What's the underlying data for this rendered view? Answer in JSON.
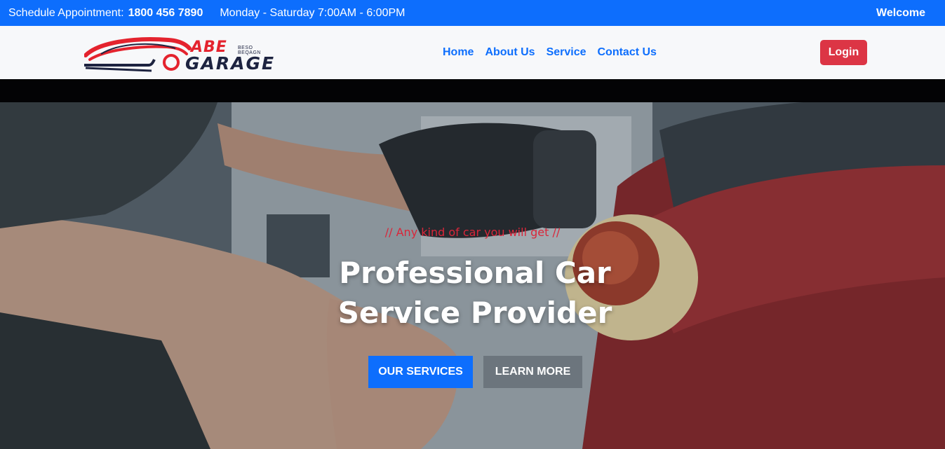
{
  "topbar": {
    "schedule_label": "Schedule Appointment:",
    "phone": "1800 456 7890",
    "hours": "Monday - Saturday 7:00AM - 6:00PM",
    "welcome": "Welcome"
  },
  "logo": {
    "line1": "ABE",
    "line2": "GARAGE",
    "tag": "BESO BEQAGN"
  },
  "nav": {
    "links": [
      "Home",
      "About Us",
      "Service",
      "Contact Us"
    ],
    "login_label": "Login"
  },
  "hero": {
    "tagline": "// Any kind of car you will get //",
    "title_line1": "Professional Car",
    "title_line2": "Service Provider",
    "primary_button": "OUR SERVICES",
    "secondary_button": "LEARN MORE"
  },
  "colors": {
    "topbar": "#0d6efd",
    "nav_link": "#0d6efd",
    "login": "#dc3545",
    "primary_button": "#0d6efd",
    "secondary_button": "#6c757d",
    "tagline": "#d9263a"
  }
}
